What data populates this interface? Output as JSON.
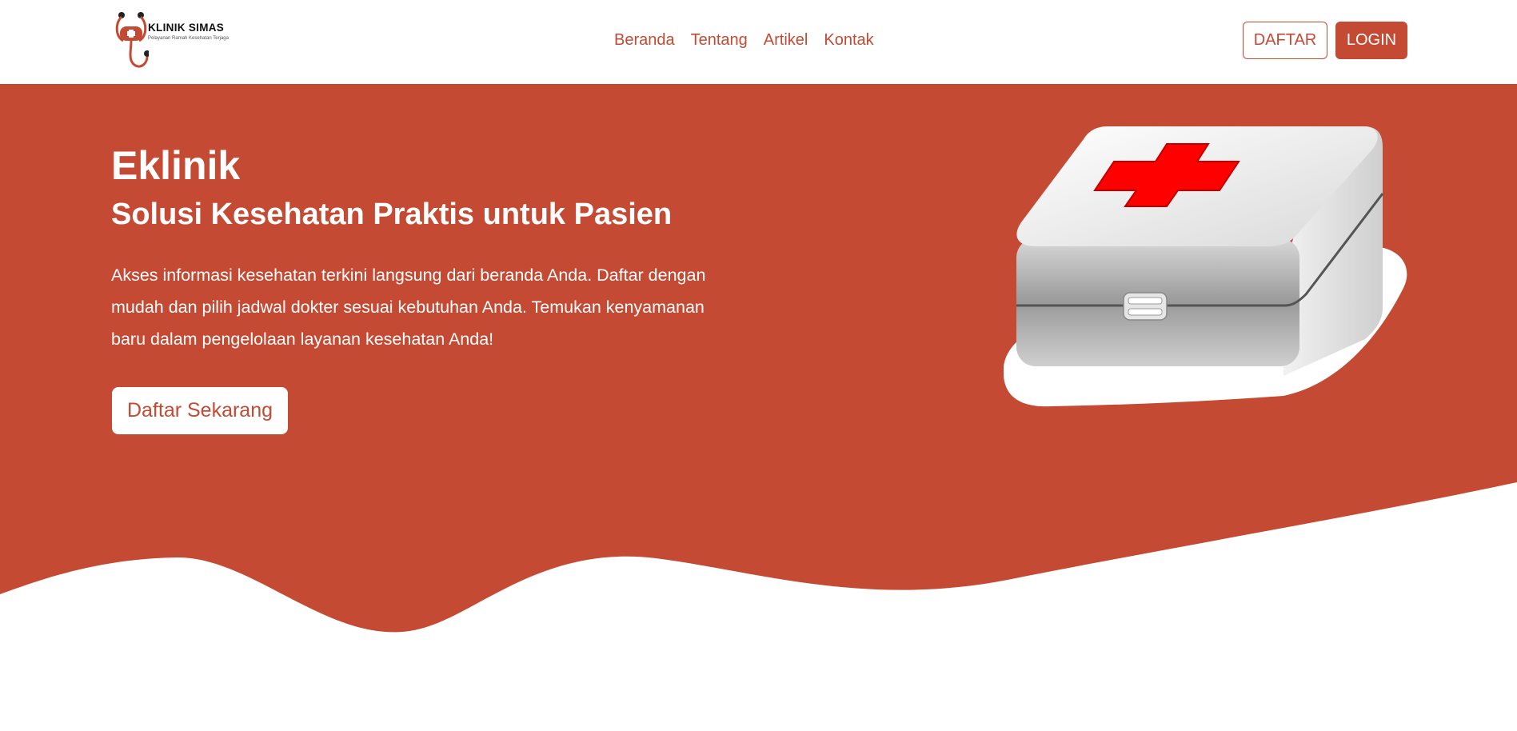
{
  "brand": {
    "name": "KLINIK SIMAS",
    "tagline": "Pelayanan Ramah Kesehatan Terjaga"
  },
  "nav": {
    "links": [
      "Beranda",
      "Tentang",
      "Artikel",
      "Kontak"
    ],
    "daftar_label": "DAFTAR",
    "login_label": "LOGIN"
  },
  "hero": {
    "title": "Eklinik",
    "subtitle": "Solusi Kesehatan Praktis untuk Pasien",
    "description": "Akses informasi kesehatan terkini langsung dari beranda Anda. Daftar dengan mudah dan pilih jadwal dokter sesuai kebutuhan Anda. Temukan kenyamanan baru dalam pengelolaan layanan kesehatan Anda!",
    "cta_label": "Daftar Sekarang",
    "illustration": "first-aid-kit-icon"
  },
  "colors": {
    "primary": "#c44a33",
    "background": "#ffffff",
    "kit_cross": "#ff0000"
  }
}
